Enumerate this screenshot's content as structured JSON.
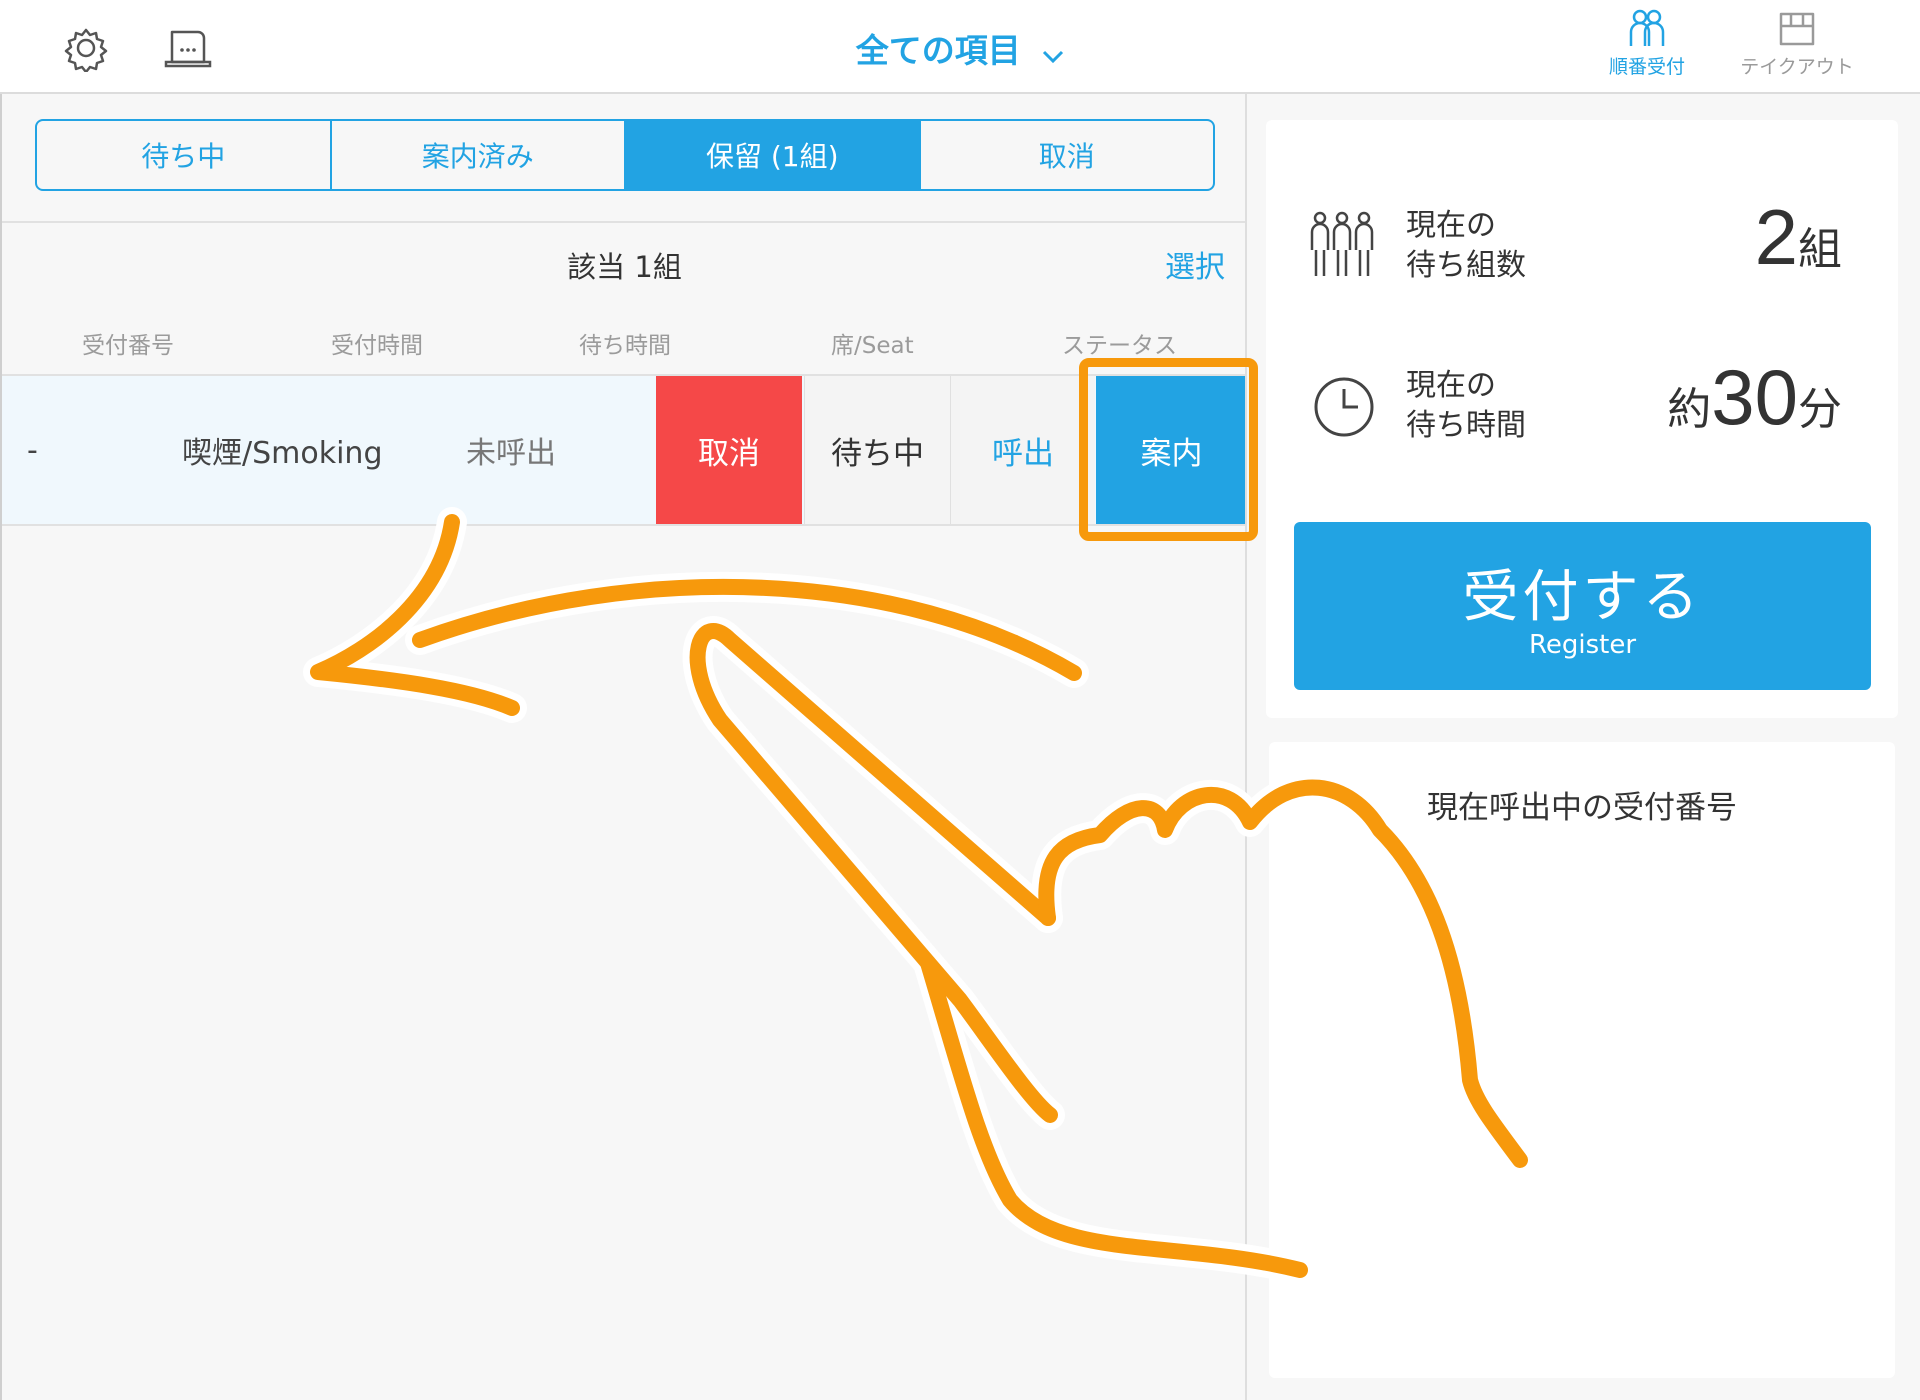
{
  "header": {
    "title": "全ての項目",
    "nav": [
      {
        "label": "順番受付",
        "icon": "people-icon",
        "active": true
      },
      {
        "label": "テイクアウト",
        "icon": "takeout-box-icon",
        "active": false
      }
    ],
    "left_icons": [
      "settings-gear-icon",
      "printer-icon"
    ]
  },
  "tabs": [
    {
      "label": "待ち中",
      "active": false
    },
    {
      "label": "案内済み",
      "active": false
    },
    {
      "label": "保留 (1組)",
      "active": true
    },
    {
      "label": "取消",
      "active": false
    }
  ],
  "list": {
    "count_text": "該当 1組",
    "select_label": "選択",
    "columns": [
      "受付番号",
      "受付時間",
      "待ち時間",
      "席/Seat",
      "ステータス"
    ],
    "row": {
      "number": "-",
      "seat": "喫煙/Smoking",
      "status": "未呼出"
    },
    "swipe_actions": [
      "取消",
      "待ち中",
      "呼出",
      "案内"
    ]
  },
  "stats": {
    "groups_label_line1": "現在の",
    "groups_label_line2": "待ち組数",
    "groups_value": "2",
    "groups_unit": "組",
    "time_label_line1": "現在の",
    "time_label_line2": "待ち時間",
    "time_prefix": "約",
    "time_value": "30",
    "time_unit": "分"
  },
  "register": {
    "label": "受付する",
    "sublabel": "Register"
  },
  "calling": {
    "title": "現在呼出中の受付番号"
  },
  "colors": {
    "accent": "#22a3e3",
    "danger": "#f54848",
    "annotation": "#f7990c"
  }
}
